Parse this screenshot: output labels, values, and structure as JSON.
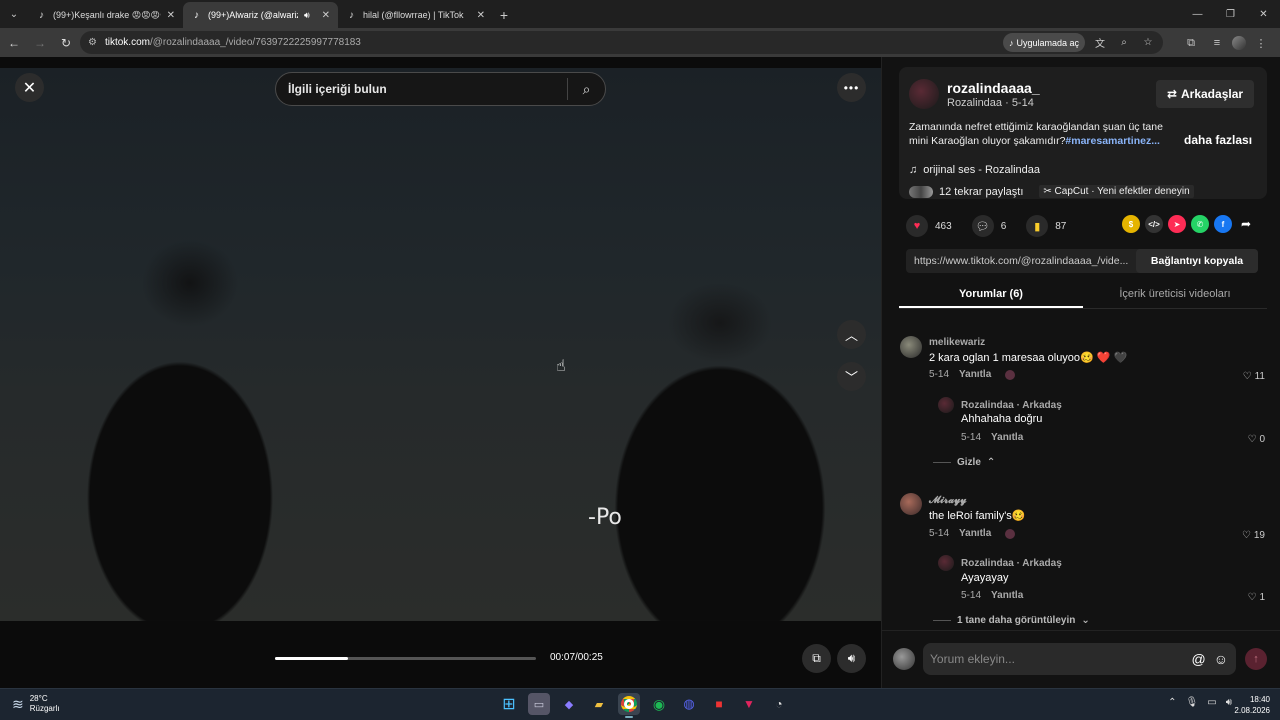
{
  "browser": {
    "tabs": [
      {
        "title": "(99+)Keşanlı drake 😡😡😡😡",
        "active": false
      },
      {
        "title": "(99+)Alwariz (@alwariz_) | T",
        "active": true
      },
      {
        "title": "hilal (@fllowrrae) | TikTok",
        "active": false
      }
    ],
    "url_host": "tiktok.com",
    "url_path": "/@rozalindaaaa_/video/7639722225997778183",
    "open_in_app": "Uygulamada aç"
  },
  "video": {
    "search_placeholder": "İlgili içeriği bulun",
    "subtitle": "-Po",
    "time": "00:07/00:25",
    "progress": 0.28
  },
  "post": {
    "username": "rozalindaaaa_",
    "subline": "Rozalindaa · 5-14",
    "friends_button": "Arkadaşlar",
    "description": "Zamanında nefret ettiğimiz karaoğlandan şuan üç tane mini Karaoğlan oluyor şakamıdır?",
    "hashtag": "#maresamartinez...",
    "more": "daha fazlası",
    "music": "orijinal ses - Rozalindaa",
    "shares": "12 tekrar paylaştı",
    "capcut": "CapCut · Yeni efektler deneyin",
    "likes": "463",
    "comments_count": "6",
    "saves": "87",
    "link": "https://www.tiktok.com/@rozalindaaaa_/vide...",
    "copy_link": "Bağlantıyı kopyala",
    "tab_comments": "Yorumlar (6)",
    "tab_creator": "İçerik üreticisi videoları"
  },
  "comments": [
    {
      "name": "melikewariz",
      "text": "2 kara oglan 1 maresaa oluyoo🥴 ❤️ 🖤",
      "date": "5-14",
      "reply": "Yanıtla",
      "likes": "11"
    },
    {
      "name": "Rozalindaa · Arkadaş",
      "text": "Ahhahaha doğru",
      "date": "5-14",
      "reply": "Yanıtla",
      "likes": "0"
    },
    {
      "toggle": "Gizle"
    },
    {
      "name": "𝓜𝓲𝓻𝓪𝔂𝔂",
      "text": "the leRoi family's🥴",
      "date": "5-14",
      "reply": "Yanıtla",
      "likes": "19"
    },
    {
      "name": "Rozalindaa · Arkadaş",
      "text": "Ayayayay",
      "date": "5-14",
      "reply": "Yanıtla",
      "likes": "1"
    },
    {
      "toggle": "1 tane daha görüntüleyin"
    }
  ],
  "comment_input": {
    "placeholder": "Yorum ekleyin..."
  },
  "taskbar": {
    "temp": "28°C",
    "weather": "Rüzgarlı",
    "time": "18:40",
    "date": "2.08.2026"
  }
}
